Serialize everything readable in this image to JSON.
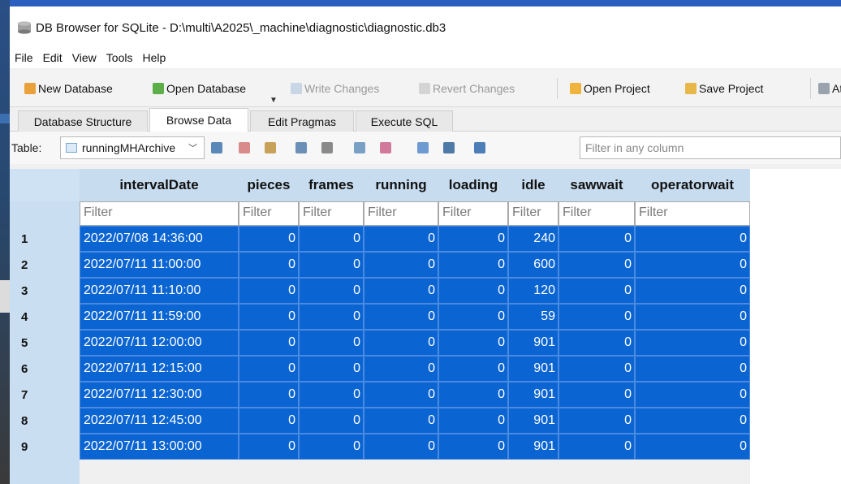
{
  "window": {
    "title": "DB Browser for SQLite - D:\\multi\\A2025\\_machine\\diagnostic\\diagnostic.db3"
  },
  "menu": [
    "File",
    "Edit",
    "View",
    "Tools",
    "Help"
  ],
  "toolbar": {
    "new_database": "New Database",
    "open_database": "Open Database",
    "write_changes": "Write Changes",
    "revert_changes": "Revert Changes",
    "open_project": "Open Project",
    "save_project": "Save Project",
    "attach": "At"
  },
  "tabs": [
    "Database Structure",
    "Browse Data",
    "Edit Pragmas",
    "Execute SQL"
  ],
  "active_tab": "Browse Data",
  "browse": {
    "table_label": "Table:",
    "table_name": "runningMHArchive",
    "filter_any_placeholder": "Filter in any column",
    "filter_placeholder": "Filter"
  },
  "columns": [
    "intervalDate",
    "pieces",
    "frames",
    "running",
    "loading",
    "idle",
    "sawwait",
    "operatorwait"
  ],
  "rows": [
    {
      "n": "1",
      "cells": [
        "2022/07/08 14:36:00",
        "0",
        "0",
        "0",
        "0",
        "240",
        "0",
        "0"
      ]
    },
    {
      "n": "2",
      "cells": [
        "2022/07/11 11:00:00",
        "0",
        "0",
        "0",
        "0",
        "600",
        "0",
        "0"
      ]
    },
    {
      "n": "3",
      "cells": [
        "2022/07/11 11:10:00",
        "0",
        "0",
        "0",
        "0",
        "120",
        "0",
        "0"
      ]
    },
    {
      "n": "4",
      "cells": [
        "2022/07/11 11:59:00",
        "0",
        "0",
        "0",
        "0",
        "59",
        "0",
        "0"
      ]
    },
    {
      "n": "5",
      "cells": [
        "2022/07/11 12:00:00",
        "0",
        "0",
        "0",
        "0",
        "901",
        "0",
        "0"
      ]
    },
    {
      "n": "6",
      "cells": [
        "2022/07/11 12:15:00",
        "0",
        "0",
        "0",
        "0",
        "901",
        "0",
        "0"
      ]
    },
    {
      "n": "7",
      "cells": [
        "2022/07/11 12:30:00",
        "0",
        "0",
        "0",
        "0",
        "901",
        "0",
        "0"
      ]
    },
    {
      "n": "8",
      "cells": [
        "2022/07/11 12:45:00",
        "0",
        "0",
        "0",
        "0",
        "901",
        "0",
        "0"
      ]
    },
    {
      "n": "9",
      "cells": [
        "2022/07/11 13:00:00",
        "0",
        "0",
        "0",
        "0",
        "901",
        "0",
        "0"
      ]
    }
  ],
  "colors": {
    "selection": "#0a64d2",
    "header": "#c7dcef",
    "rownum": "#c9def0"
  }
}
